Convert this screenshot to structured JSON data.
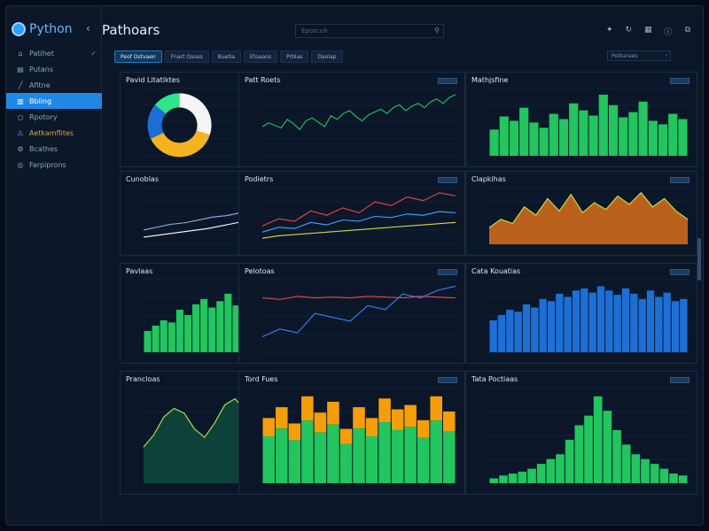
{
  "app": {
    "brand": "Python",
    "title": "Pathoars"
  },
  "sidebar": {
    "items": [
      {
        "label": "Patihet",
        "icon": "home-icon"
      },
      {
        "label": "Putans",
        "icon": "folder-icon"
      },
      {
        "label": "Afitne",
        "icon": "chart-icon"
      },
      {
        "label": "Bbling",
        "icon": "document-icon",
        "active": true
      },
      {
        "label": "Rpotory",
        "icon": "circle-icon"
      },
      {
        "label": "Aetkamflites",
        "icon": "warning-icon",
        "accent": true
      },
      {
        "label": "Bcathes",
        "icon": "gear-icon"
      },
      {
        "label": "Farpiprons",
        "icon": "settings-icon"
      }
    ]
  },
  "header": {
    "search_placeholder": "Eposcuh"
  },
  "tabs": [
    "Peof Ostvaen",
    "Fnart Osoas",
    "Buetia",
    "Etoaans",
    "Prblas",
    "Daolap"
  ],
  "panel_select": {
    "value": "Petkaraes"
  },
  "cards": [
    {
      "title": "Pavid Litatiktes"
    },
    {
      "title": "Patt Roets"
    },
    {
      "title": "Mathjsfine"
    },
    {
      "title": "Cunoblas"
    },
    {
      "title": "Podietrs"
    },
    {
      "title": "Clapkihas"
    },
    {
      "title": "Pavlaas"
    },
    {
      "title": "Pelotoas"
    },
    {
      "title": "Cata Kouatias"
    },
    {
      "title": "Prancloas"
    },
    {
      "title": "Tord Fues"
    },
    {
      "title": "Tata Poctiaas"
    }
  ],
  "colors": {
    "accent": "#1e88e5",
    "green": "#22c55e",
    "orange": "#f59e0b",
    "blue": "#1d6fd6",
    "red": "#ef4444"
  },
  "chart_data": [
    {
      "type": "pie",
      "values": [
        30,
        38,
        18,
        14
      ],
      "colors": [
        "#f5f5f5",
        "#f5b321",
        "#1d6fd6",
        "#2fe58a"
      ]
    },
    {
      "type": "line",
      "series": [
        {
          "values": [
            40,
            45,
            42,
            38,
            50,
            44,
            36,
            48,
            52,
            46,
            40,
            55,
            50,
            58,
            62,
            54,
            48,
            56,
            60,
            64,
            58,
            66,
            70,
            62,
            68,
            72,
            66,
            74,
            78,
            72,
            80,
            84
          ]
        }
      ]
    },
    {
      "type": "bar",
      "values": [
        30,
        45,
        40,
        55,
        38,
        32,
        48,
        42,
        60,
        52,
        46,
        70,
        58,
        44,
        50,
        62,
        40,
        36,
        48,
        42
      ]
    },
    {
      "type": "line",
      "series": [
        {
          "values": [
            20,
            24,
            28,
            30,
            34,
            38,
            40,
            44,
            50,
            54,
            58,
            62,
            66,
            70,
            72
          ]
        },
        {
          "values": [
            10,
            14,
            18,
            22,
            28,
            34,
            42,
            50,
            36,
            44
          ]
        }
      ]
    },
    {
      "type": "line",
      "series": [
        {
          "values": [
            30,
            42,
            38,
            55,
            48,
            60,
            52,
            70,
            64,
            78,
            72,
            85,
            80
          ]
        },
        {
          "values": [
            20,
            28,
            26,
            36,
            32,
            40,
            38,
            46,
            44,
            50,
            48,
            54,
            52
          ]
        },
        {
          "values": [
            10,
            14,
            16,
            18,
            20,
            22,
            24,
            26,
            28,
            30,
            32,
            34,
            36
          ]
        }
      ]
    },
    {
      "type": "area",
      "values": [
        20,
        30,
        25,
        45,
        35,
        55,
        40,
        60,
        38,
        50,
        42,
        58,
        48,
        62,
        45,
        55,
        40,
        30
      ]
    },
    {
      "type": "bar",
      "values": [
        20,
        25,
        30,
        28,
        40,
        35,
        45,
        50,
        42,
        48,
        55,
        44,
        52,
        58,
        46,
        50,
        62,
        55,
        48,
        60,
        45,
        52,
        38,
        30
      ]
    },
    {
      "type": "line",
      "series": [
        {
          "values": [
            70,
            68,
            72,
            70,
            71,
            70,
            72,
            71,
            70,
            72,
            71,
            70
          ]
        },
        {
          "values": [
            20,
            30,
            25,
            50,
            45,
            40,
            60,
            55,
            75,
            70,
            80,
            85
          ]
        }
      ]
    },
    {
      "type": "bar",
      "values": [
        30,
        35,
        40,
        38,
        45,
        42,
        50,
        48,
        55,
        52,
        58,
        60,
        56,
        62,
        58,
        54,
        60,
        55,
        50,
        58,
        52,
        56,
        48,
        50
      ]
    },
    {
      "type": "area",
      "values": [
        30,
        40,
        55,
        62,
        58,
        45,
        38,
        50,
        65,
        70,
        60,
        48,
        42,
        55,
        68,
        72,
        62,
        50,
        45,
        58
      ]
    },
    {
      "type": "bar",
      "values": [
        60,
        70,
        55,
        80,
        65,
        75,
        50,
        70,
        60,
        78,
        68,
        72,
        58,
        80,
        66
      ]
    },
    {
      "type": "bar",
      "values": [
        5,
        8,
        10,
        12,
        15,
        20,
        25,
        30,
        45,
        60,
        70,
        90,
        75,
        55,
        40,
        30,
        25,
        20,
        15,
        10,
        8
      ]
    }
  ]
}
